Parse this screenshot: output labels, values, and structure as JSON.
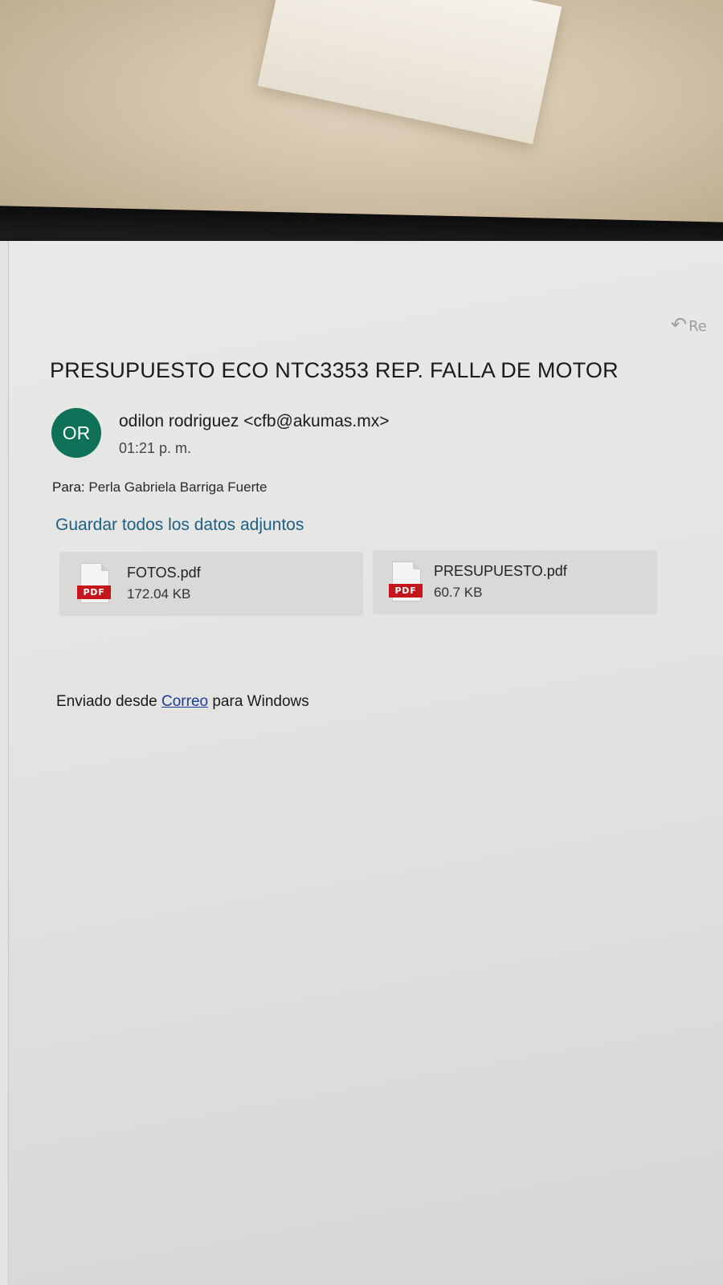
{
  "header": {
    "reply_icon": "reply-arrow-icon",
    "reply_label": "Re"
  },
  "message": {
    "subject": "PRESUPUESTO ECO NTC3353 REP. FALLA DE MOTOR",
    "avatar_initials": "OR",
    "avatar_color": "#0f7158",
    "sender": "odilon rodriguez <cfb@akumas.mx>",
    "time": "01:21 p. m.",
    "to_label": "Para:",
    "to_value": "Perla Gabriela Barriga Fuerte",
    "save_all_label": "Guardar todos los datos adjuntos",
    "save_all_color": "#1f5f86"
  },
  "attachments": [
    {
      "icon": "pdf-file-icon",
      "icon_tag": "PDF",
      "name": "FOTOS.pdf",
      "size": "172.04 KB"
    },
    {
      "icon": "pdf-file-icon",
      "icon_tag": "PDF",
      "name": "PRESUPUESTO.pdf",
      "size": "60.7 KB"
    }
  ],
  "body": {
    "signature_prefix": "Enviado desde",
    "signature_link": "Correo",
    "signature_suffix": "para Windows"
  }
}
